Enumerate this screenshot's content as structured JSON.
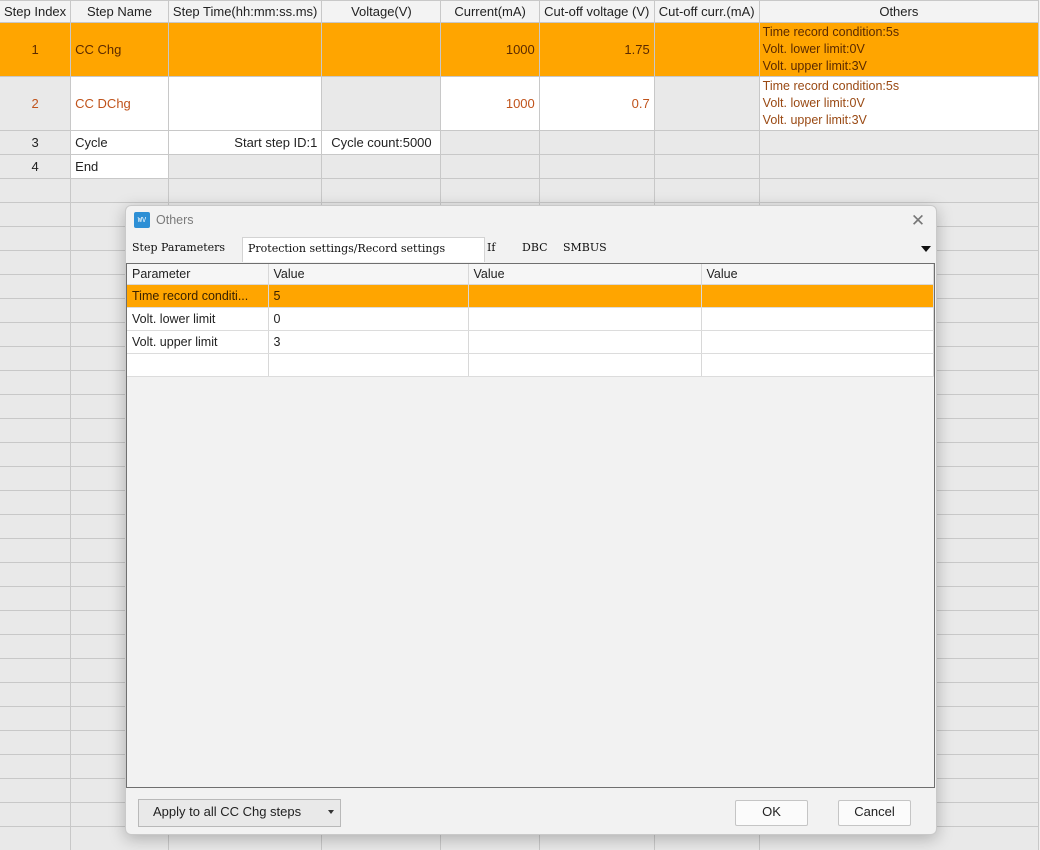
{
  "grid": {
    "headers": [
      "Step Index",
      "Step Name",
      "Step Time(hh:mm:ss.ms)",
      "Voltage(V)",
      "Current(mA)",
      "Cut-off voltage (V)",
      "Cut-off curr.(mA)",
      "Others"
    ],
    "rows": [
      {
        "index": "1",
        "name": "CC Chg",
        "time": "",
        "voltage": "",
        "current": "1000",
        "cutoff_v": "1.75",
        "cutoff_c": "",
        "others": [
          "Time record condition:5s",
          "Volt. lower limit:0V",
          "Volt. upper limit:3V"
        ]
      },
      {
        "index": "2",
        "name": "CC DChg",
        "time": "",
        "voltage": "",
        "current": "1000",
        "cutoff_v": "0.7",
        "cutoff_c": "",
        "others": [
          "Time record condition:5s",
          "Volt. lower limit:0V",
          "Volt. upper limit:3V"
        ]
      },
      {
        "index": "3",
        "name": "Cycle",
        "time": "Start step ID:1",
        "voltage": "Cycle count:5000"
      },
      {
        "index": "4",
        "name": "End"
      }
    ],
    "colors": {
      "selected_row": "#ffa500",
      "discharge_text": "#c0531b"
    }
  },
  "dialog": {
    "title": "Others",
    "icon": "app-logo-icon",
    "app_icon_text": "WV",
    "tabs": [
      "Step Parameters",
      "Protection settings/Record settings",
      "If",
      "DBC",
      "SMBUS"
    ],
    "active_tab": "Protection settings/Record settings",
    "param_headers": [
      "Parameter",
      "Value",
      "Value",
      "Value"
    ],
    "params": [
      {
        "name": "Time record conditi...",
        "value": "5"
      },
      {
        "name": "Volt. lower limit",
        "value": "0"
      },
      {
        "name": "Volt. upper limit",
        "value": "3"
      }
    ],
    "apply_label": "Apply to all CC Chg steps",
    "ok_label": "OK",
    "cancel_label": "Cancel"
  }
}
